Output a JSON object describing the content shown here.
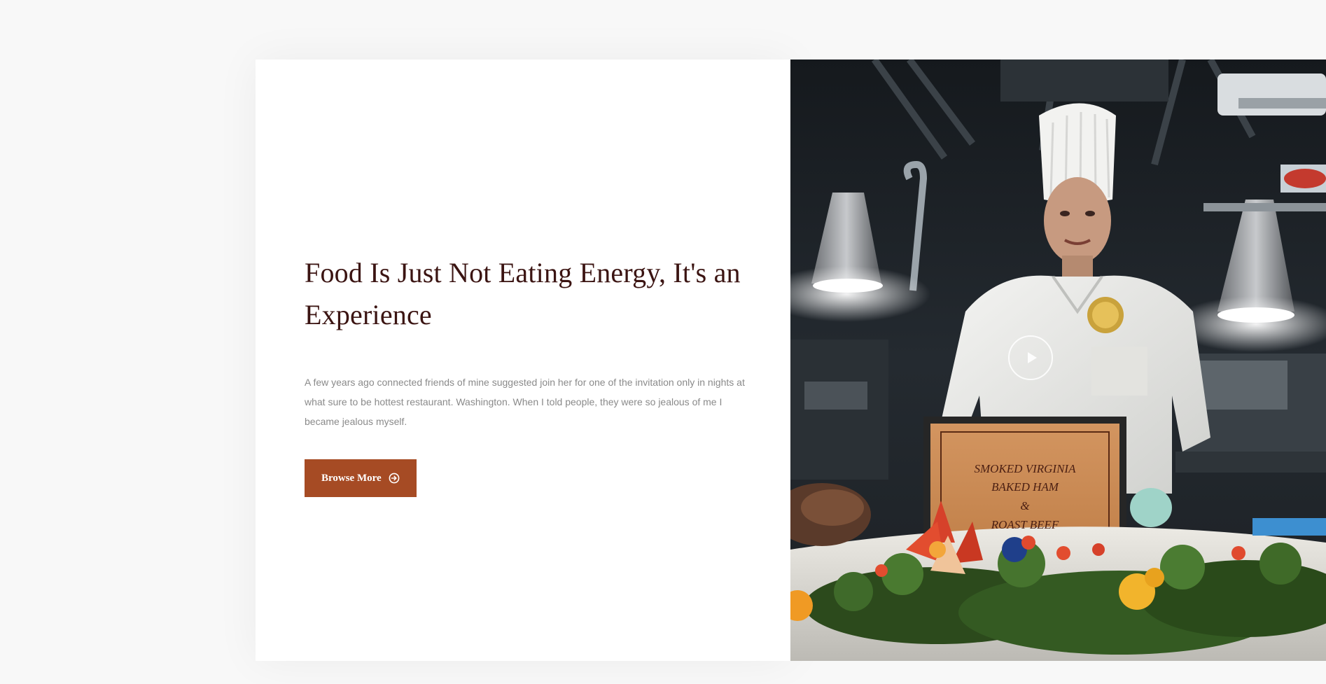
{
  "about": {
    "headline": "Food Is Just Not Eating Energy, It's an Experience",
    "description": "A few years ago connected friends of mine suggested join her for one of the invitation only in nights at what sure to be hottest restaurant. Washington. When I told people, they were so jealous of me I became jealous myself.",
    "button_label": "Browse More",
    "button_icon": "arrow-circle-right-icon"
  },
  "video": {
    "play_icon": "play-icon",
    "sign_lines": [
      "SMOKED VIRGINIA",
      "BAKED HAM",
      "&",
      "ROAST BEEF"
    ]
  },
  "colors": {
    "accent": "#a64b24",
    "headline": "#3b1412",
    "body_text": "#8a8a8a",
    "background": "#f8f8f8"
  }
}
